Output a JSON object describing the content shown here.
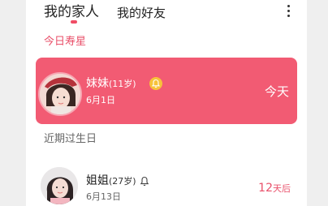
{
  "tabs": {
    "family": "我的家人",
    "friends": "我的好友"
  },
  "sections": {
    "today": "今日寿星",
    "recent": "近期过生日"
  },
  "today_card": {
    "name": "妹妹",
    "age": "(11岁)",
    "date": "6月1日",
    "status": "今天"
  },
  "upcoming": [
    {
      "name": "姐姐",
      "age": "(27岁)",
      "date": "6月13日",
      "days_num": "12",
      "days_unit": "天后"
    }
  ],
  "colors": {
    "accent": "#f04c65",
    "card": "#f25b73",
    "badge": "#f7c23a"
  }
}
